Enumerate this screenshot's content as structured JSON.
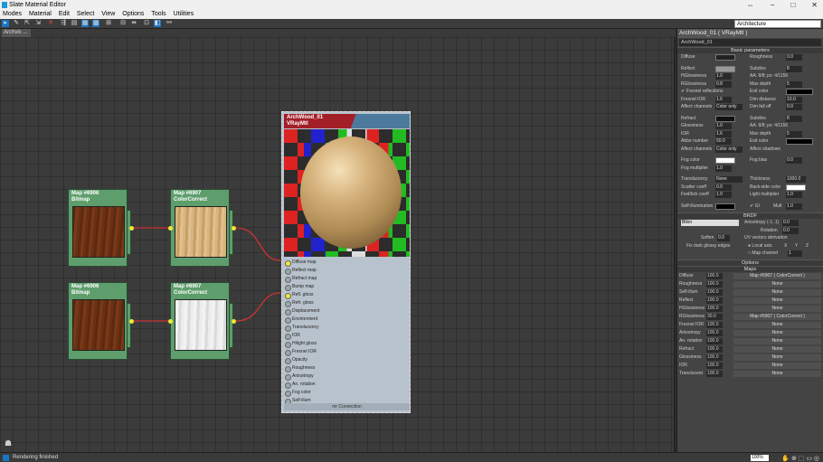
{
  "window": {
    "title": "Slate Material Editor",
    "min": "−",
    "max": "□",
    "close": "✕",
    "pin": "⇔"
  },
  "menu": [
    "Modes",
    "Material",
    "Edit",
    "Select",
    "View",
    "Options",
    "Tools",
    "Utilities"
  ],
  "toolbar": {
    "dropdown": "Architecture"
  },
  "tab": "Archvis ...",
  "nodes": [
    {
      "title": "Map #6906",
      "sub": "Bitmap"
    },
    {
      "title": "Map #6907",
      "sub": "ColorCorrect"
    },
    {
      "title": "Map #6906",
      "sub": "Bitmap"
    },
    {
      "title": "Map #6907",
      "sub": "ColorCorrect"
    }
  ],
  "material": {
    "title": "ArchWood_01",
    "sub": "VRayMtl",
    "slots": [
      "Diffuse map",
      "Reflect map",
      "Refract map",
      "Bump map",
      "Refl. gloss",
      "Refr. gloss",
      "Displacement",
      "Environment",
      "Translucency",
      "IOR",
      "Hilight gloss",
      "Fresnel IOR",
      "Opacity",
      "Roughness",
      "Anisotropy",
      "An. rotation",
      "Fog color",
      "Self-illum"
    ],
    "connection": "mr Connection"
  },
  "panel": {
    "title": "ArchWood_01  ( VRayMtl )",
    "name": "ArchWood_01",
    "basic": "Basic parameters",
    "diffuse": "Diffuse",
    "roughness": "Roughness",
    "roughness_val": "0.0",
    "reflect": "Reflect",
    "subdivs": "Subdivs",
    "subdivs_val": "8",
    "aa": "AA: 8/8; px: 4/1156",
    "hilight": "HGlossiness",
    "hilight_val": "1.0",
    "rgloss": "RGlossiness",
    "rgloss_val": "0.8",
    "maxdepth": "Max depth",
    "maxdepth_val": "5",
    "fresnel": "Fresnel reflections",
    "exitcolor": "Exit color",
    "fresnel_ior": "Fresnel IOR",
    "fresnel_ior_val": "1.6",
    "dimdist": "Dim distance",
    "dimdist_val": "10.0",
    "affect": "Affect channels",
    "affect_val": "Color only",
    "dimfall": "Dim fall off",
    "dimfall_val": "0.0",
    "refract": "Refract",
    "rsubdivs_val": "8",
    "aa2": "AA: 8/8; px: 4/1156",
    "glossiness": "Glossiness",
    "gloss_val": "1.0",
    "ior": "IOR",
    "ior_val": "1.6",
    "maxdepth2_val": "5",
    "abbe": "Abbe number",
    "abbe_val": "50.0",
    "exit2": "Exit color",
    "affect2_val": "Color only",
    "affect_shadows": "Affect shadows",
    "fogcolor": "Fog color",
    "fogbias": "Fog bias",
    "fogbias_val": "0.0",
    "fogmult": "Fog multiplier",
    "fogmult_val": "1.0",
    "translucency": "Translucency",
    "trans_val": "None",
    "thickness": "Thickness",
    "thickness_val": "1000.0",
    "scatter": "Scatter coeff",
    "scatter_val": "0.0",
    "backside": "Back-side color",
    "fwdbck": "Fwd/bck coeff",
    "fwdbck_val": "1.0",
    "lightmult": "Light multiplier",
    "lightmult_val": "1.0",
    "selfillum": "Self-illumination",
    "gi": "GI",
    "mult": "Mult",
    "mult_val": "1.0",
    "brdf": "BRDF",
    "brdf_type": "Blinn",
    "aniso": "Anisotropy (-1..1)",
    "aniso_val": "0.0",
    "rotation": "Rotation",
    "rotation_val": "0.0",
    "soften": "Soften",
    "soften_val": "0.0",
    "uvderiv": "UV vectors derivation",
    "localaxis": "Local axis",
    "x": "X",
    "y": "Y",
    "z": "Z",
    "fixdark": "Fix dark glossy edges",
    "mapchan": "Map channel",
    "mapchan_val": "1",
    "options": "Options",
    "maps": "Maps"
  },
  "maps": [
    {
      "n": "Diffuse",
      "a": "100.0",
      "m": "Map #6907  ( ColorCorrect )"
    },
    {
      "n": "Roughness",
      "a": "100.0",
      "m": "None"
    },
    {
      "n": "Self-illum",
      "a": "100.0",
      "m": "None"
    },
    {
      "n": "Reflect",
      "a": "100.0",
      "m": "None"
    },
    {
      "n": "HGlossiness",
      "a": "100.0",
      "m": "None"
    },
    {
      "n": "RGlossiness",
      "a": "30.0",
      "m": "Map #6907  ( ColorCorrect )"
    },
    {
      "n": "Fresnel IOR",
      "a": "100.0",
      "m": "None"
    },
    {
      "n": "Anisotropy",
      "a": "100.0",
      "m": "None"
    },
    {
      "n": "An. rotation",
      "a": "100.0",
      "m": "None"
    },
    {
      "n": "Refract",
      "a": "100.0",
      "m": "None"
    },
    {
      "n": "Glossiness",
      "a": "100.0",
      "m": "None"
    },
    {
      "n": "IOR",
      "a": "100.0",
      "m": "None"
    },
    {
      "n": "Translucent",
      "a": "100.0",
      "m": "None"
    }
  ],
  "status": {
    "text": "Rendering finished",
    "zoom": "100%"
  }
}
